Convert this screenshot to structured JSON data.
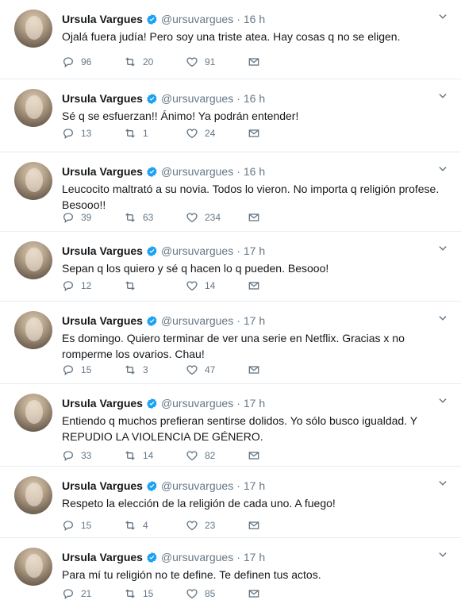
{
  "account": {
    "name": "Ursula Vargues",
    "handle": "@ursuvargues",
    "verified_color": "#1da1f2"
  },
  "icons": {
    "reply": "reply-icon",
    "retweet": "retweet-icon",
    "like": "heart-icon",
    "dm": "envelope-icon",
    "more": "chevron-down-icon",
    "verified": "verified-badge-icon"
  },
  "tweets": [
    {
      "time": "16 h",
      "text": "Ojalá fuera judía! Pero soy una triste atea. Hay cosas q no se eligen.",
      "replies": "96",
      "retweets": "20",
      "likes": "91"
    },
    {
      "time": "16 h",
      "text": "Sé q se esfuerzan!! Ánimo! Ya podrán entender!",
      "replies": "13",
      "retweets": "1",
      "likes": "24"
    },
    {
      "time": "16 h",
      "text": "Leucocito maltrató a su novia. Todos lo vieron. No importa q religión profese. Besooo!!",
      "replies": "39",
      "retweets": "63",
      "likes": "234"
    },
    {
      "time": "17 h",
      "text": "Sepan q los quiero y sé q hacen lo q pueden. Besooo!",
      "replies": "12",
      "retweets": "",
      "likes": "14"
    },
    {
      "time": "17 h",
      "text": "Es domingo. Quiero terminar de ver una serie en Netflix. Gracias x no romperme los ovarios. Chau!",
      "replies": "15",
      "retweets": "3",
      "likes": "47"
    },
    {
      "time": "17 h",
      "text": "Entiendo q muchos prefieran sentirse dolidos. Yo sólo busco igualdad. Y REPUDIO LA VIOLENCIA DE GÉNERO.",
      "replies": "33",
      "retweets": "14",
      "likes": "82"
    },
    {
      "time": "17 h",
      "text": "Respeto la elección de la religión de cada uno. A fuego!",
      "replies": "15",
      "retweets": "4",
      "likes": "23"
    },
    {
      "time": "17 h",
      "text": "Para mí tu religión no te define. Te definen tus actos.",
      "replies": "21",
      "retweets": "15",
      "likes": "85"
    }
  ]
}
